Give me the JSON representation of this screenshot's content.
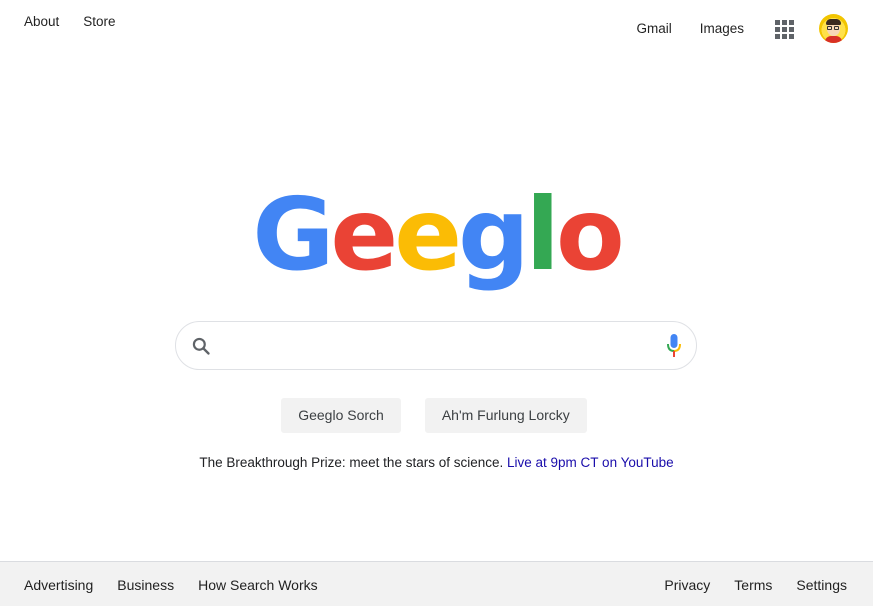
{
  "header": {
    "left_links": [
      "About",
      "Store"
    ],
    "right_links": [
      "Gmail",
      "Images"
    ],
    "apps_icon": "apps-grid-icon",
    "avatar_icon": "user-avatar"
  },
  "logo": {
    "letters": [
      {
        "char": "G",
        "color": "#4285F4"
      },
      {
        "char": "e",
        "color": "#EA4335"
      },
      {
        "char": "e",
        "color": "#FBBC05"
      },
      {
        "char": "g",
        "color": "#4285F4"
      },
      {
        "char": "l",
        "color": "#34A853"
      },
      {
        "char": "o",
        "color": "#EA4335"
      }
    ]
  },
  "search": {
    "value": "",
    "placeholder": "",
    "search_icon": "search-icon",
    "mic_icon": "microphone-icon"
  },
  "buttons": {
    "search_label": "Geeglo Sorch",
    "lucky_label": "Ah'm Furlung Lorcky"
  },
  "promo": {
    "text": "The Breakthrough Prize: meet the stars of science.",
    "link": "Live at 9pm CT on YouTube"
  },
  "footer": {
    "left_links": [
      "Advertising",
      "Business",
      "How Search Works"
    ],
    "right_links": [
      "Privacy",
      "Terms",
      "Settings"
    ]
  }
}
